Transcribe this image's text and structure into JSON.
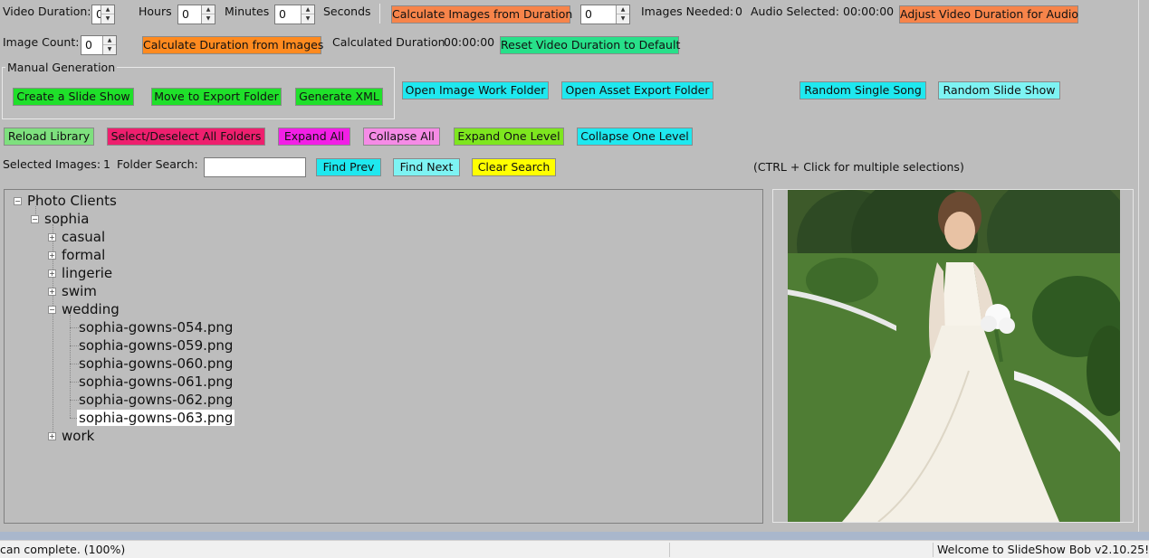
{
  "duration": {
    "label": "Video Duration:",
    "hours_value": "0",
    "hours_label": "Hours",
    "minutes_value": "0",
    "minutes_label": "Minutes",
    "seconds_value": "0",
    "seconds_label": "Seconds",
    "calc_images_button": "Calculate Images from Duration",
    "images_needed_value": "0",
    "images_needed_label": "Images Needed:",
    "images_needed_count": "0",
    "audio_selected_label": "Audio Selected:",
    "audio_selected_value": "00:00:00",
    "adjust_button": "Adjust Video Duration for Audio"
  },
  "image_count": {
    "label": "Image Count:",
    "value": "0",
    "calc_duration_button": "Calculate Duration from Images",
    "calculated_label": "Calculated Duration",
    "calculated_value": "00:00:00",
    "reset_button": "Reset Video Duration to Default"
  },
  "manual_generation": {
    "title": "Manual Generation",
    "create_button": "Create a Slide Show",
    "move_button": "Move to Export Folder",
    "xml_button": "Generate XML"
  },
  "folders": {
    "open_image_button": "Open Image Work Folder",
    "open_asset_button": "Open Asset Export Folder",
    "random_song_button": "Random Single Song",
    "random_show_button": "Random Slide Show"
  },
  "tree_controls": {
    "reload": "Reload Library",
    "select_all": "Select/Deselect All Folders",
    "expand_all": "Expand All",
    "collapse_all": "Collapse All",
    "expand_one": "Expand One Level",
    "collapse_one": "Collapse One Level"
  },
  "search": {
    "selected_label": "Selected Images:",
    "selected_count": "1",
    "folder_search_label": "Folder Search:",
    "query": "",
    "find_prev": "Find Prev",
    "find_next": "Find Next",
    "clear": "Clear Search",
    "hint": "(CTRL + Click for multiple selections)"
  },
  "tree": {
    "root": "Photo Clients",
    "client": "sophia",
    "folders": [
      "casual",
      "formal",
      "lingerie",
      "swim",
      "wedding"
    ],
    "files": [
      "sophia-gowns-054.png",
      "sophia-gowns-059.png",
      "sophia-gowns-060.png",
      "sophia-gowns-061.png",
      "sophia-gowns-062.png",
      "sophia-gowns-063.png"
    ],
    "last_folder": "work"
  },
  "status": {
    "left": "can complete. (100%)",
    "right": "Welcome to SlideShow Bob v2.10.25!"
  }
}
